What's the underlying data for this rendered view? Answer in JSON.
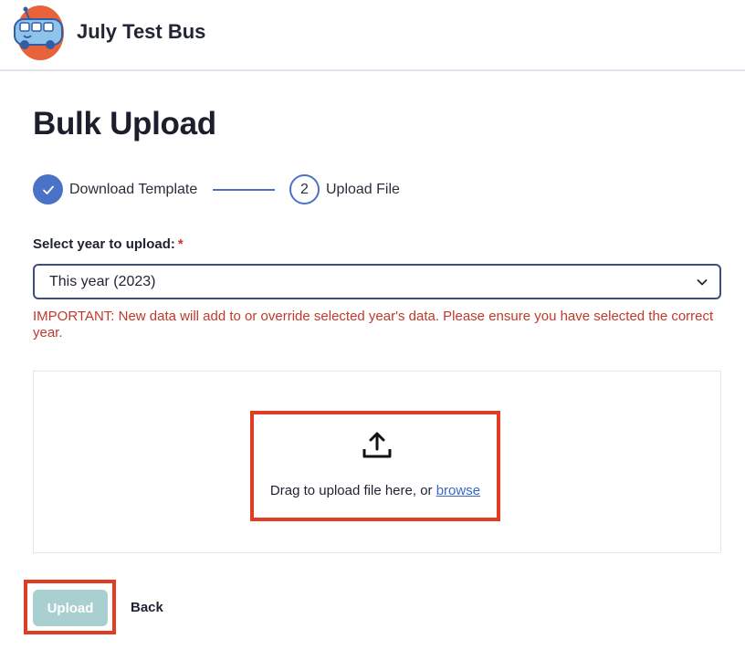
{
  "header": {
    "app_title": "July Test Bus",
    "logo_icon": "bus-logo-icon"
  },
  "page": {
    "title": "Bulk Upload"
  },
  "stepper": {
    "steps": [
      {
        "label": "Download Template",
        "status": "complete",
        "icon": "check-icon"
      },
      {
        "number": "2",
        "label": "Upload File",
        "status": "current"
      }
    ]
  },
  "year_field": {
    "label": "Select year to upload:",
    "required_mark": "*",
    "selected_value": "This year (2023)"
  },
  "warning_text": "IMPORTANT: New data will add to or override selected year's data. Please ensure you have selected the correct year.",
  "dropzone": {
    "icon": "upload-icon",
    "text": "Drag to upload file here, or ",
    "browse_label": "browse"
  },
  "actions": {
    "upload_label": "Upload",
    "back_label": "Back"
  },
  "colors": {
    "primary": "#4a72c6",
    "warning": "#c0392b",
    "highlight": "#e23c22",
    "upload_disabled": "#a9cfd1",
    "logo_blob": "#e8623a"
  }
}
